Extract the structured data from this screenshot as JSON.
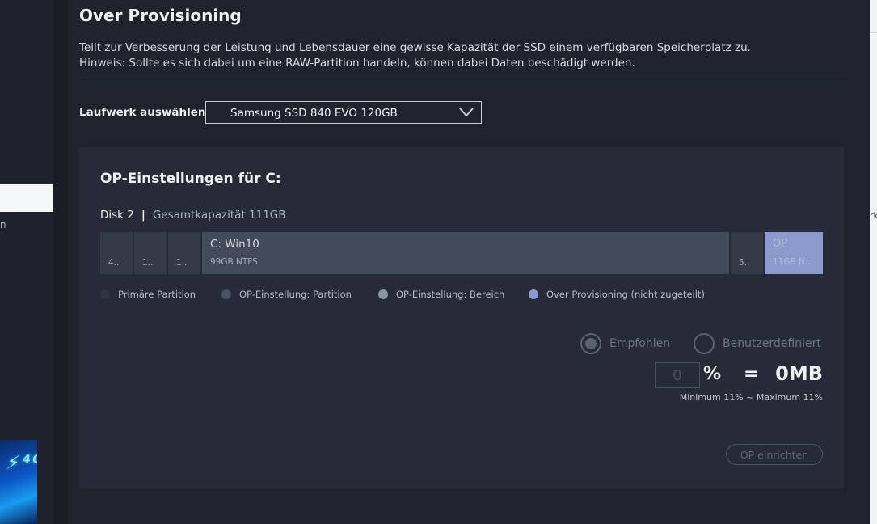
{
  "sidebar": {
    "partial_item_text": "n"
  },
  "page": {
    "title": "Over Provisioning",
    "description_line1": "Teilt zur Verbesserung der Leistung und Lebensdauer eine gewisse Kapazität der SSD einem verfügbaren Speicherplatz zu.",
    "description_line2": "Hinweis: Sollte es sich dabei um eine RAW-Partition handeln, können dabei Daten beschädigt werden."
  },
  "drive_select": {
    "label": "Laufwerk auswählen",
    "value": "Samsung SSD 840 EVO 120GB"
  },
  "op_settings": {
    "title": "OP-Einstellungen für  C:",
    "disk_name": "Disk 2",
    "disk_capacity": "Gesamtkapazität 111GB",
    "partitions": [
      {
        "label": "4..",
        "size_fraction": 0.045
      },
      {
        "label": "1..",
        "size_fraction": 0.045
      },
      {
        "label": "1..",
        "size_fraction": 0.045
      },
      {
        "name": "C: Win10",
        "sub": "99GB NTFS",
        "size_fraction": 0.73
      },
      {
        "label": "5..",
        "size_fraction": 0.045
      },
      {
        "name": "OP",
        "sub": "11GB N..",
        "size_fraction": 0.08
      }
    ],
    "legend": [
      {
        "label": "Primäre Partition",
        "color": "#2f3442"
      },
      {
        "label": "OP-Einstellung: Partition",
        "color": "#4b5160"
      },
      {
        "label": "OP-Einstellung: Bereich",
        "color": "#8d93a1"
      },
      {
        "label": "Over Provisioning (nicht zugeteilt)",
        "color": "#8a9ccc"
      }
    ],
    "radio_recommended": "Empfohlen",
    "radio_custom": "Benutzerdefiniert",
    "percent_value": "0",
    "percent_sign": "%",
    "equals_sign": "=",
    "size_value": "0MB",
    "range_note": "Minimum 11% ~ Maximum 11%",
    "apply_button": "OP einrichten"
  },
  "right_edge": {
    "partial_text": "rk"
  }
}
